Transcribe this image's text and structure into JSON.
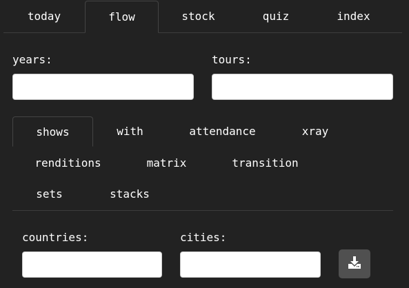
{
  "top_tabs": [
    {
      "label": "today",
      "active": false
    },
    {
      "label": "flow",
      "active": true
    },
    {
      "label": "stock",
      "active": false
    },
    {
      "label": "quiz",
      "active": false
    },
    {
      "label": "index",
      "active": false
    }
  ],
  "fields": {
    "years": {
      "label": "years:",
      "value": ""
    },
    "tours": {
      "label": "tours:",
      "value": ""
    },
    "countries": {
      "label": "countries:",
      "value": ""
    },
    "cities": {
      "label": "cities:",
      "value": ""
    }
  },
  "sub_tabs": [
    {
      "label": "shows",
      "active": true
    },
    {
      "label": "with",
      "active": false
    },
    {
      "label": "attendance",
      "active": false
    },
    {
      "label": "xray",
      "active": false
    },
    {
      "label": "renditions",
      "active": false
    },
    {
      "label": "matrix",
      "active": false
    },
    {
      "label": "transition",
      "active": false
    },
    {
      "label": "sets",
      "active": false
    },
    {
      "label": "stacks",
      "active": false
    }
  ],
  "download": {
    "icon": "download-icon"
  },
  "colors": {
    "background": "#222222",
    "button": "#505050",
    "border": "#3d3d3d"
  }
}
